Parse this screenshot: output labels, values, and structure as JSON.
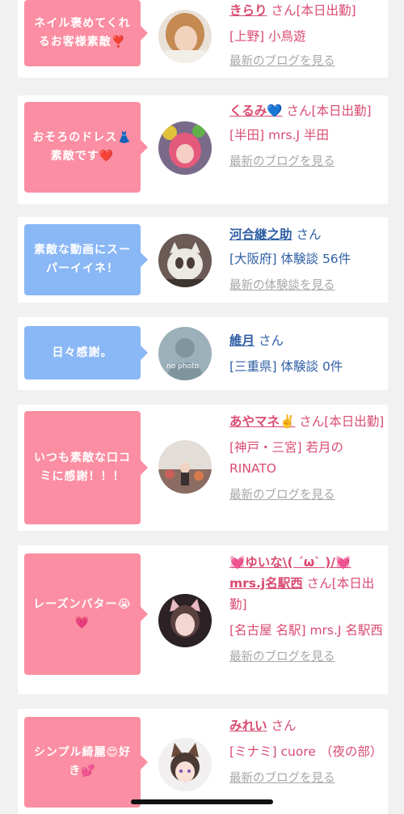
{
  "cards": [
    {
      "message": "ネイル褒めてくれるお客様素敵❣️",
      "name": "きらり",
      "suffix": "さん[本日出勤]",
      "detail": "[上野] 小鳥遊",
      "link": "最新のブログを見る",
      "avatar": "blonde-woman-photo"
    },
    {
      "message": "おそろのドレス👗素敵です❤️",
      "name": "くるみ💙",
      "suffix": "さん[本日出勤]",
      "detail": "[半田] mrs.J 半田",
      "link": "最新のブログを見る",
      "avatar": "flowers-woman-photo"
    },
    {
      "message": "素敵な動画にスーパーイイネ！",
      "name": "河合継之助",
      "suffix": "さん",
      "detail": "[大阪府] 体験談 56件",
      "link": "最新の体験談を見る",
      "avatar": "cat-photo"
    },
    {
      "message": "日々感謝。",
      "name": "維月",
      "suffix": "さん",
      "detail": "[三重県] 体験談 0件",
      "avatar": "no-photo-placeholder",
      "no_photo_text": "no photo"
    },
    {
      "message": "いつも素敵な口コミに感謝！！！",
      "name": "あやマネ✌️",
      "suffix": "さん[本日出勤]",
      "detail": "[神戸・三宮] 若月のRINATO",
      "link": "最新のブログを見る",
      "avatar": "stage-woman-photo"
    },
    {
      "message": "レーズンバター😭💗",
      "name": "💓ゆいな\\( ´ω` )/💓mrs.j名駅西",
      "suffix": "さん[本日出勤]",
      "detail": "[名古屋 名駅] mrs.J 名駅西",
      "link": "最新のブログを見る",
      "avatar": "cat-ears-woman-photo"
    },
    {
      "message": "シンプル綺麗😍好き💕",
      "name": "みれい",
      "suffix": "さん",
      "detail": "[ミナミ] cuore （夜の部）",
      "link": "最新のブログを見る",
      "avatar": "anime-girl-photo"
    }
  ],
  "colors": {
    "pink_bubble": "#fb8ea2",
    "blue_bubble": "#8ab7f5",
    "pink_text": "#d94b72",
    "blue_text": "#2f5fa5"
  }
}
